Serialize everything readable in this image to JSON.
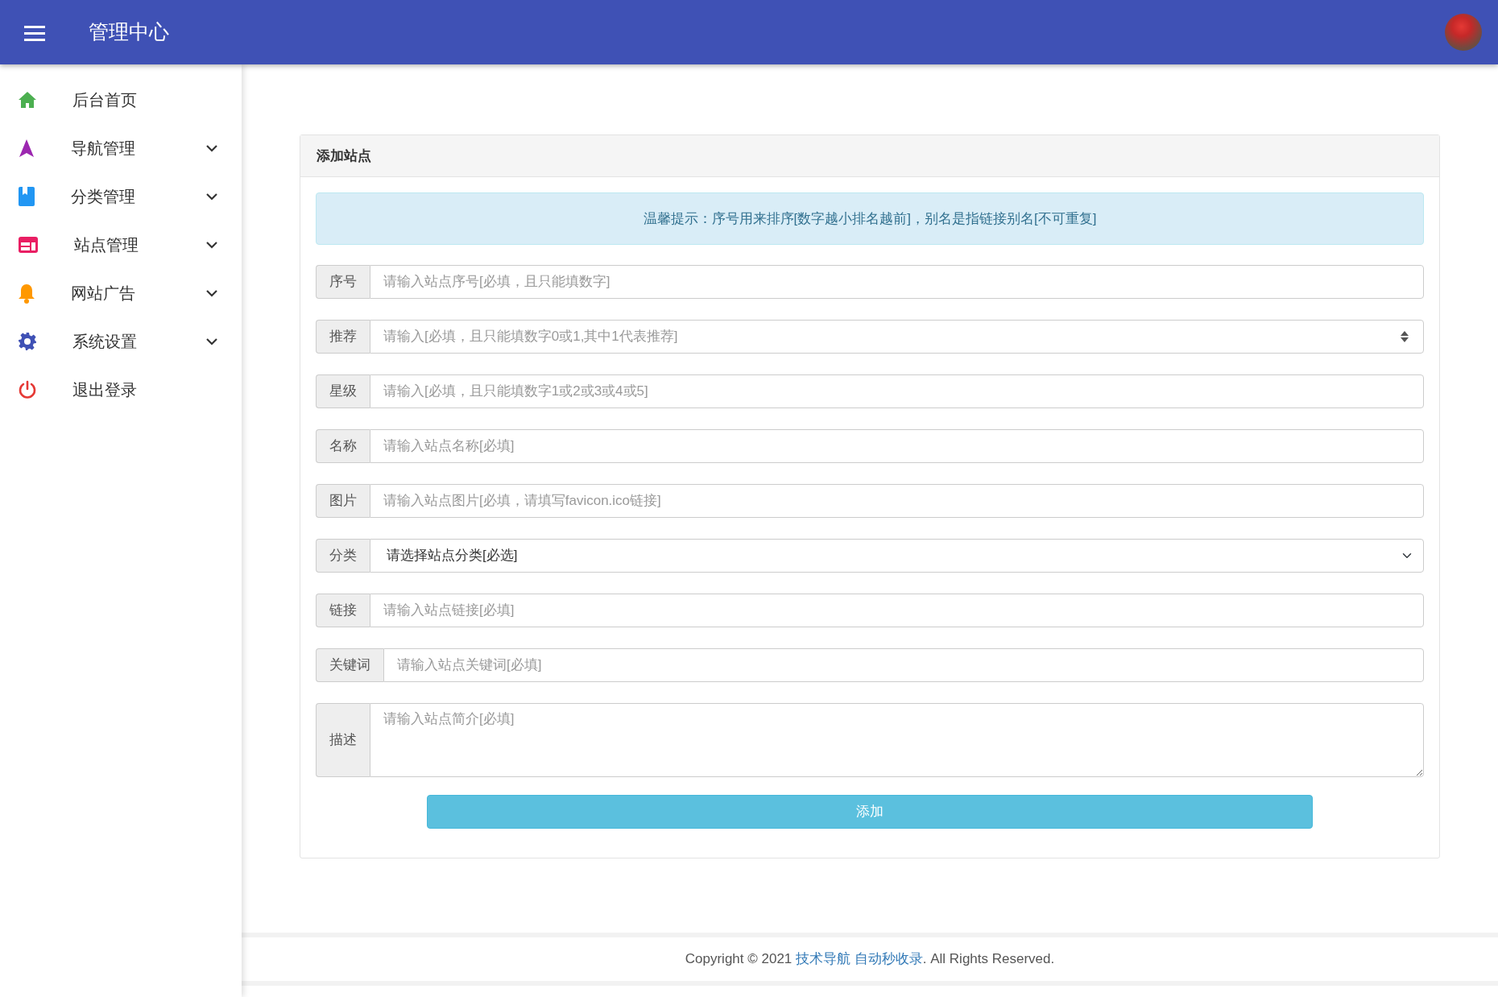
{
  "header": {
    "title": "管理中心"
  },
  "sidebar": {
    "items": [
      {
        "label": "后台首页",
        "has_submenu": false
      },
      {
        "label": "导航管理",
        "has_submenu": true
      },
      {
        "label": "分类管理",
        "has_submenu": true
      },
      {
        "label": "站点管理",
        "has_submenu": true
      },
      {
        "label": "网站广告",
        "has_submenu": true
      },
      {
        "label": "系统设置",
        "has_submenu": true
      },
      {
        "label": "退出登录",
        "has_submenu": false
      }
    ]
  },
  "form": {
    "title": "添加站点",
    "notice": "温馨提示：序号用来排序[数字越小排名越前]，别名是指链接别名[不可重复]",
    "fields": [
      {
        "kind": "text",
        "label": "序号",
        "placeholder": "请输入站点序号[必填，且只能填数字]"
      },
      {
        "kind": "number",
        "label": "推荐",
        "placeholder": "请输入[必填，且只能填数字0或1,其中1代表推荐]"
      },
      {
        "kind": "text",
        "label": "星级",
        "placeholder": "请输入[必填，且只能填数字1或2或3或4或5]"
      },
      {
        "kind": "text",
        "label": "名称",
        "placeholder": "请输入站点名称[必填]"
      },
      {
        "kind": "text",
        "label": "图片",
        "placeholder": "请输入站点图片[必填，请填写favicon.ico链接]"
      },
      {
        "kind": "select",
        "label": "分类",
        "value": "请选择站点分类[必选]"
      },
      {
        "kind": "text",
        "label": "链接",
        "placeholder": "请输入站点链接[必填]"
      },
      {
        "kind": "text",
        "label": "关键词",
        "placeholder": "请输入站点关键词[必填]"
      },
      {
        "kind": "textarea",
        "label": "描述",
        "placeholder": "请输入站点简介[必填]"
      }
    ],
    "submit": "添加"
  },
  "footer": {
    "prefix": "Copyright © 2021 ",
    "link": "技术导航 自动秒收录",
    "suffix": ". All Rights Reserved."
  }
}
